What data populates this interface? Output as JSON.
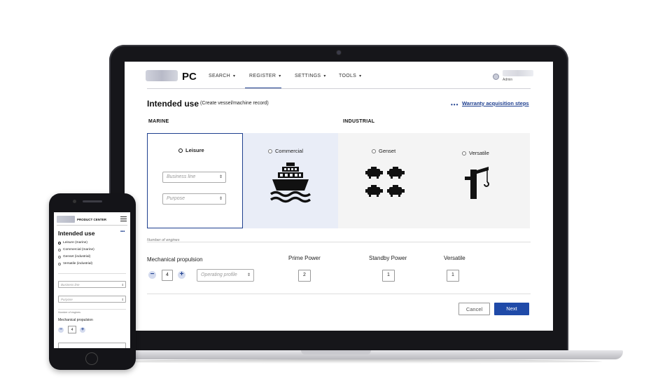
{
  "colors": {
    "accent": "#1e3f8f",
    "primary_button": "#1f4aa8",
    "selected_panel_bg": "#e9edf7",
    "panel_bg": "#f4f4f4"
  },
  "laptop": {
    "brand": "PC",
    "nav": [
      {
        "label": "SEARCH"
      },
      {
        "label": "REGISTER",
        "active": true
      },
      {
        "label": "SETTINGS"
      },
      {
        "label": "TOOLS"
      }
    ],
    "nav_caret": "▾",
    "user": {
      "role": "Admin",
      "icon": "user-avatar-icon"
    },
    "title": "Intended use",
    "subtitle": "(Create vessel/machine record)",
    "warranty_icon": "•••",
    "warranty_link": "Warranty acquisition steps",
    "sections": {
      "marine": "MARINE",
      "industrial": "INDUSTRIAL"
    },
    "options": {
      "leisure": {
        "label": "Leisure",
        "selected": true
      },
      "commercial": {
        "label": "Commercial",
        "icon": "ship-icon"
      },
      "genset": {
        "label": "Genset",
        "icon": "generator-set-icon"
      },
      "versatile": {
        "label": "Versatile",
        "icon": "crane-icon"
      }
    },
    "business_line_placeholder": "Business line",
    "purpose_placeholder": "Purpose",
    "select_arrow": "⇕",
    "number_of_engines_label": "Number of engines",
    "mechanical_propulsion": {
      "label": "Mechanical propulsion",
      "value": "4",
      "minus": "−",
      "plus": "+"
    },
    "operating_profile_placeholder": "Operating profile",
    "prime_power": {
      "label": "Prime Power",
      "value": "2"
    },
    "standby_power": {
      "label": "Standby Power",
      "value": "1"
    },
    "versatile_count": {
      "label": "Versatile",
      "value": "1"
    },
    "cancel": "Cancel",
    "next": "Next"
  },
  "phone": {
    "brand": "PRODUCT CENTER",
    "title": "Intended use",
    "dots": "•••",
    "options": [
      {
        "label": "Leisure (marine)",
        "selected": true
      },
      {
        "label": "Commercial (marine)"
      },
      {
        "label": "Genset (industrial)"
      },
      {
        "label": "Versatile (industrial)"
      }
    ],
    "business_line_placeholder": "Business line",
    "purpose_placeholder": "Purpose",
    "number_of_engines_label": "Number of engines",
    "mechanical_propulsion": "Mechanical propulsion",
    "engine_count": "4",
    "minus": "−",
    "plus": "+"
  }
}
